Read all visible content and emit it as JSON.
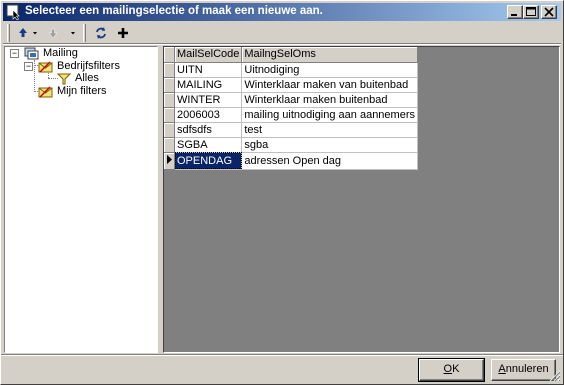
{
  "window": {
    "title": "Selecteer een mailingselectie of maak een nieuwe aan.",
    "icon": "app-cursor-icon",
    "controls": [
      "minimize",
      "maximize",
      "close"
    ]
  },
  "toolbar": {
    "buttons": [
      {
        "name": "move-up",
        "icon": "arrow-up-icon",
        "enabled": true
      },
      {
        "name": "move-down",
        "icon": "arrow-down-icon",
        "enabled": false
      },
      {
        "name": "refresh",
        "icon": "refresh-icon",
        "enabled": true
      },
      {
        "name": "add",
        "icon": "plus-icon",
        "enabled": true
      }
    ]
  },
  "tree": {
    "root": "Mailing",
    "company_filters": "Bedrijfsfilters",
    "all": "Alles",
    "my_filters": "Mijn filters"
  },
  "grid": {
    "columns": [
      "MailSelCode",
      "MailngSelOms"
    ],
    "rows": [
      {
        "code": "UITN",
        "desc": "Uitnodiging"
      },
      {
        "code": "MAILING",
        "desc": "Winterklaar maken van buitenbad"
      },
      {
        "code": "WINTER",
        "desc": "Winterklaar maken buitenbad"
      },
      {
        "code": "2006003",
        "desc": "mailing uitnodiging aan aannemers"
      },
      {
        "code": "sdfsdfs",
        "desc": "test"
      },
      {
        "code": "SGBA",
        "desc": "sgba"
      },
      {
        "code": "OPENDAG",
        "desc": "adressen Open dag"
      }
    ],
    "selected_row": 6
  },
  "buttons": {
    "ok_u": "O",
    "ok_rest": "K",
    "cancel_u": "A",
    "cancel_rest": "nnuleren"
  },
  "colors": {
    "title_start": "#0a246a",
    "title_end": "#a6caf0",
    "face": "#d4d0c8",
    "selection": "#0a246a"
  }
}
